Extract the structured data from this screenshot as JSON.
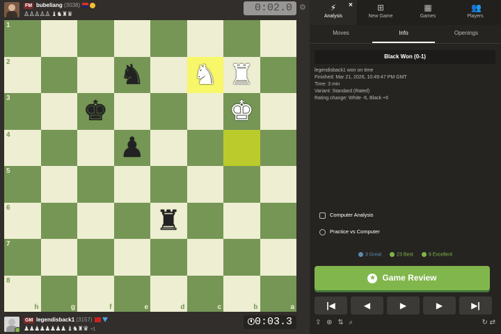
{
  "top_player": {
    "title": "FM",
    "name": "bubeliang",
    "rating": "(3038)",
    "captured": "♙♙♙♙♙ ♝♞♜♛",
    "clock": "0:02.0"
  },
  "bottom_player": {
    "title": "GM",
    "name": "legendisback1",
    "rating": "(3157)",
    "captured": "♟♟♟♟♟♟♟♟ ♝♞♜♛",
    "advantage": "+1",
    "clock": "0:03.3"
  },
  "board": {
    "orientation": "black",
    "light_color": "#eeeed2",
    "dark_color": "#769656",
    "highlight_colors": [
      "#f7f769",
      "#bbcb2b"
    ],
    "rank_labels": [
      "1",
      "2",
      "3",
      "4",
      "5",
      "6",
      "7",
      "8"
    ],
    "file_labels": [
      "h",
      "g",
      "f",
      "e",
      "d",
      "c",
      "b",
      "a"
    ],
    "pieces": [
      {
        "square": "e2",
        "piece": "♞",
        "color": "black",
        "name": "black-knight"
      },
      {
        "square": "c2",
        "piece": "♞",
        "color": "white",
        "name": "white-knight"
      },
      {
        "square": "b2",
        "piece": "♜",
        "color": "white",
        "name": "white-rook"
      },
      {
        "square": "f3",
        "piece": "♚",
        "color": "black",
        "name": "black-king"
      },
      {
        "square": "b3",
        "piece": "♚",
        "color": "white",
        "name": "white-king"
      },
      {
        "square": "e4",
        "piece": "♟",
        "color": "black",
        "name": "black-pawn"
      },
      {
        "square": "d6",
        "piece": "♜",
        "color": "black",
        "name": "black-rook"
      }
    ],
    "highlights": [
      "c2",
      "b4"
    ]
  },
  "nav": {
    "tabs": [
      {
        "label": "Analysis",
        "icon": "lightning-icon"
      },
      {
        "label": "New Game",
        "icon": "plus-square-icon"
      },
      {
        "label": "Games",
        "icon": "chessboard-icon"
      },
      {
        "label": "Players",
        "icon": "players-icon"
      }
    ],
    "close": "×"
  },
  "subtabs": [
    "Moves",
    "Info",
    "Openings"
  ],
  "result": "Black Won (0-1)",
  "info": {
    "line1": "legendisback1 won on time",
    "line2": "Finished: Mar 21, 2026, 10:49:47 PM GMT",
    "line3": "Time: 3 min",
    "line4": "Variant: Standard (Rated)",
    "line5": "Rating change: White -6, Black +6"
  },
  "tools": {
    "computer_analysis": "Computer Analysis",
    "practice": "Practice vs Computer"
  },
  "stats": {
    "great": "3 Great",
    "best": "23 Best",
    "excellent": "9 Excellent",
    "great_color": "#5c8bb0",
    "best_color": "#81b64c",
    "excellent_color": "#81b64c"
  },
  "review_button": "Game Review",
  "controls": [
    "|◀",
    "◀",
    "▶",
    "▶",
    "▶|"
  ]
}
